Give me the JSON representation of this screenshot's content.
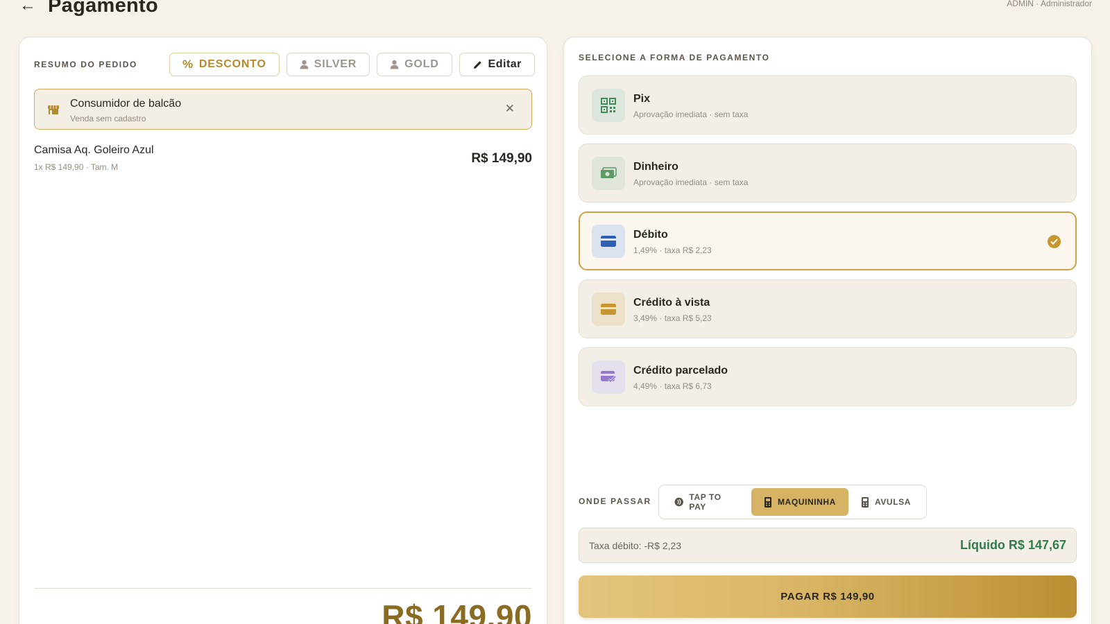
{
  "header": {
    "back_icon": "arrow-left-icon",
    "title": "Pagamento",
    "user": "ADMIN · Administrador"
  },
  "order": {
    "section_label": "RESUMO DO PEDIDO",
    "chips": {
      "discount": "DESCONTO",
      "silver": "SILVER",
      "gold": "GOLD",
      "edit": "Editar"
    },
    "customer": {
      "name": "Consumidor de balcão",
      "subtitle": "Venda sem cadastro"
    },
    "items": [
      {
        "name": "Camisa Aq. Goleiro Azul",
        "meta": "1x R$ 149,90 · Tam. M",
        "price": "R$ 149,90"
      }
    ],
    "total": "R$ 149,90"
  },
  "payment": {
    "section_label": "SELECIONE A FORMA DE PAGAMENTO",
    "methods": [
      {
        "name": "Pix",
        "sub": "Aprovação imediata · sem taxa",
        "icon": "qr-code-icon",
        "selected": false
      },
      {
        "name": "Dinheiro",
        "sub": "Aprovação imediata · sem taxa",
        "icon": "cash-icon",
        "selected": false
      },
      {
        "name": "Débito",
        "sub": "1,49% · taxa R$ 2,23",
        "icon": "debit-card-icon",
        "selected": true
      },
      {
        "name": "Crédito à vista",
        "sub": "3,49% · taxa R$ 5,23",
        "icon": "credit-card-icon",
        "selected": false
      },
      {
        "name": "Crédito parcelado",
        "sub": "4,49% · taxa R$ 6,73",
        "icon": "installment-card-icon",
        "selected": false
      }
    ],
    "onde_label": "ONDE PASSAR",
    "terminals": [
      {
        "label": "TAP TO PAY",
        "active": false
      },
      {
        "label": "MAQUININHA",
        "active": true
      },
      {
        "label": "AVULSA",
        "active": false
      }
    ],
    "fee_text": "Taxa débito: -R$ 2,23",
    "net_text": "Líquido R$ 147,67",
    "pay_button": "PAGAR R$ 149,90"
  },
  "colors": {
    "accent": "#c5972e",
    "selected_border": "#cfa24a",
    "net_green": "#2f7d4a",
    "total_gold": "#8a6b22"
  }
}
